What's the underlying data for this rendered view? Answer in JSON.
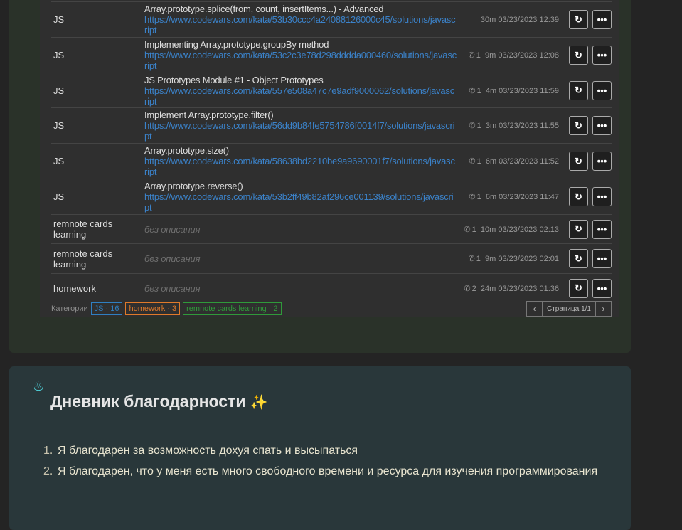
{
  "rows": [
    {
      "category": "JS",
      "title": "Array.prototype.splice(from, count, insertItems...) - Advanced",
      "url": "https://www.codewars.com/kata/53b30ccc4a24088126000c45/solutions/javascript",
      "calls": "",
      "duration": "30m",
      "date": "03/23/2023 12:39"
    },
    {
      "category": "JS",
      "title": "Implementing Array.prototype.groupBy method",
      "url": "https://www.codewars.com/kata/53c2c3e78d298dddda000460/solutions/javascript",
      "calls": "1",
      "duration": "9m",
      "date": "03/23/2023 12:08"
    },
    {
      "category": "JS",
      "title": "JS Prototypes Module #1 - Object Prototypes",
      "url": "https://www.codewars.com/kata/557e508a47c7e9adf9000062/solutions/javascript",
      "calls": "1",
      "duration": "4m",
      "date": "03/23/2023 11:59"
    },
    {
      "category": "JS",
      "title": "Implement Array.prototype.filter()",
      "url": "https://www.codewars.com/kata/56dd9b84fe5754786f0014f7/solutions/javascript",
      "calls": "1",
      "duration": "3m",
      "date": "03/23/2023 11:55"
    },
    {
      "category": "JS",
      "title": "Array.prototype.size()",
      "url": "https://www.codewars.com/kata/58638bd2210be9a9690001f7/solutions/javascript",
      "calls": "1",
      "duration": "6m",
      "date": "03/23/2023 11:52"
    },
    {
      "category": "JS",
      "title": "Array.prototype.reverse()",
      "url": "https://www.codewars.com/kata/53b2ff49b82af296ce001139/solutions/javascript",
      "calls": "1",
      "duration": "6m",
      "date": "03/23/2023 11:47"
    },
    {
      "category": "remnote cards learning",
      "none": "без описания",
      "calls": "1",
      "duration": "10m",
      "date": "03/23/2023 02:13"
    },
    {
      "category": "remnote cards learning",
      "none": "без описания",
      "calls": "1",
      "duration": "9m",
      "date": "03/23/2023 02:01"
    },
    {
      "category": "homework",
      "none": "без описания",
      "calls": "2",
      "duration": "24m",
      "date": "03/23/2023 01:36"
    }
  ],
  "footer": {
    "label": "Категории",
    "tags": [
      {
        "text": "JS · 16",
        "color": "#2f7fc1"
      },
      {
        "text": "homework · 3",
        "color": "#e07a2a"
      },
      {
        "text": "remnote cards learning · 2",
        "color": "#2f9a3a"
      }
    ],
    "page": "Страница 1/1"
  },
  "diary": {
    "title": "Дневник благодарности",
    "items": [
      "Я благодарен за возможность дохуя спать и высыпаться",
      "Я благодарен, что у меня есть много свободного времени и ресурса для изучения программирования"
    ]
  }
}
